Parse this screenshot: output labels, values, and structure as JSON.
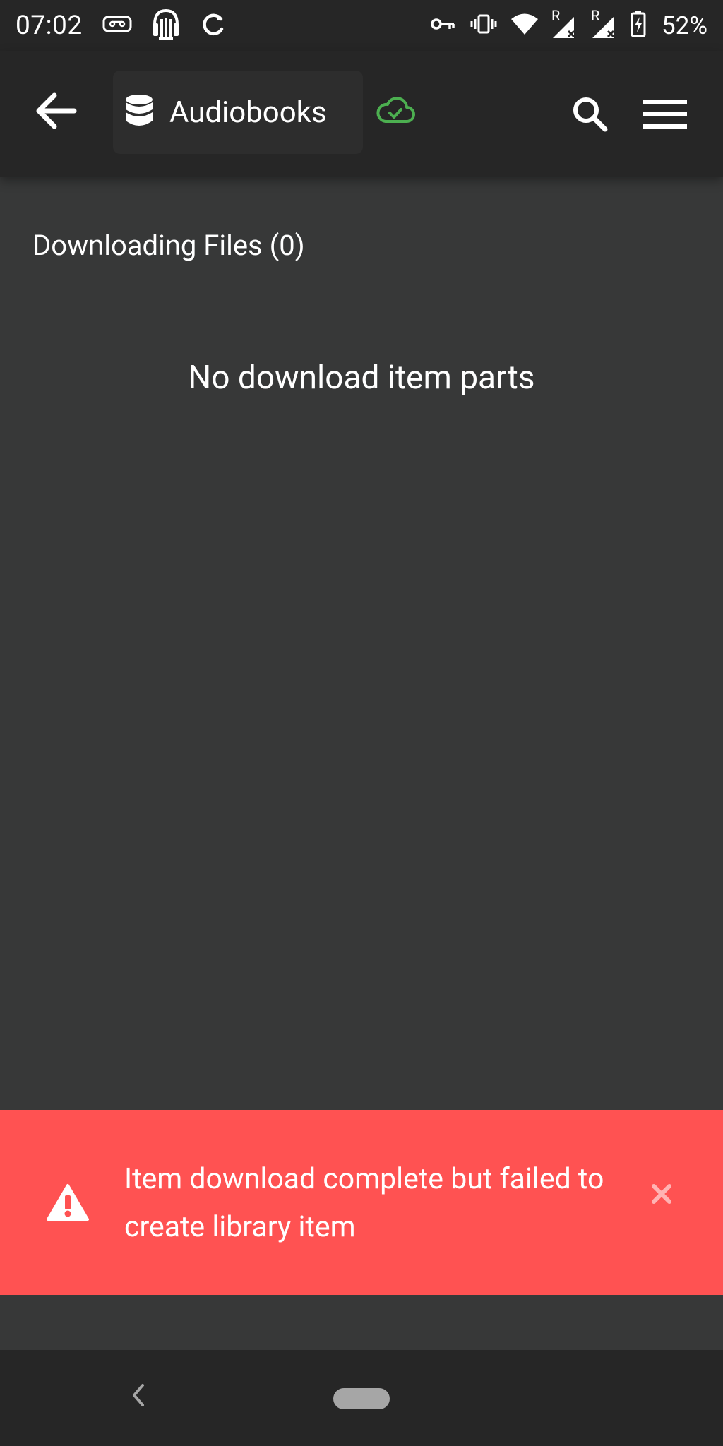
{
  "status_bar": {
    "time": "07:02",
    "battery": "52%",
    "icons": [
      "cassette-icon",
      "audiobookshelf-icon",
      "sync-icon",
      "vpn-key-icon",
      "vibrate-icon",
      "wifi-icon",
      "signal-r-icon",
      "signal-r-icon",
      "battery-charging-icon"
    ],
    "roaming_label": "R"
  },
  "app_bar": {
    "back_icon": "arrow-left-icon",
    "library_icon": "database-icon",
    "library_name": "Audiobooks",
    "cloud_icon": "cloud-check-icon",
    "search_icon": "search-icon",
    "menu_icon": "menu-icon"
  },
  "main": {
    "section_title": "Downloading Files (0)",
    "empty_message": "No download item parts"
  },
  "toast": {
    "icon": "warning-icon",
    "message": "Item download complete but failed to create library item",
    "close_icon": "close-icon"
  },
  "navigation_bar": {
    "back_icon": "nav-back-icon",
    "home_icon": "nav-home-pill"
  },
  "colors": {
    "background": "#373838",
    "bars": "#262626",
    "chip": "#2d2d2d",
    "cloud_ok": "#4caf50",
    "toast": "#ff5252"
  }
}
